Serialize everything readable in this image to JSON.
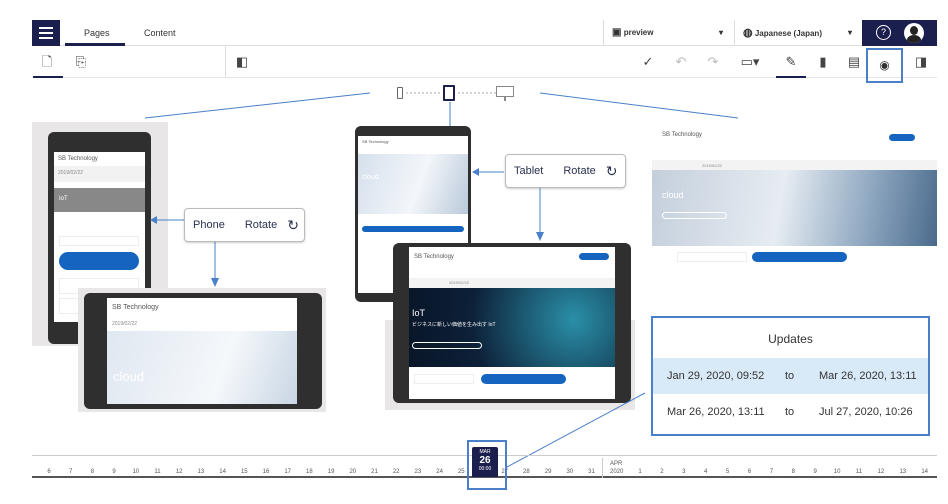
{
  "header": {
    "tabs": [
      {
        "label": "Pages",
        "active": true
      },
      {
        "label": "Content"
      }
    ],
    "environment": "preview",
    "language": "Japanese (Japan)"
  },
  "icons": [
    "menu-icon",
    "page-icon",
    "asset-icon",
    "collapse-panel-icon",
    "check-circle-icon",
    "undo-icon",
    "redo-icon",
    "monitor-icon",
    "pencil-icon",
    "analytics-icon",
    "form-icon",
    "eye-icon",
    "help-icon",
    "avatar-icon",
    "phone-icon",
    "tablet-icon",
    "desktop-icon",
    "rotate-icon"
  ],
  "colors": {
    "navy": "#1b1f4e",
    "highlight": "#4a7fc9",
    "site_blue": "#1565c0",
    "row_highlight": "#d8e9f7"
  },
  "phone_callout": {
    "device": "Phone",
    "rotate": "Rotate"
  },
  "tablet_callout": {
    "device": "Tablet",
    "rotate": "Rotate"
  },
  "site": {
    "logo": "SB Technology",
    "date": "2019/02/22",
    "hero_cloud": "cloud",
    "hero_iot": "IoT",
    "iot_sub": "ビジネスに新しい価値を生み出す IoT"
  },
  "updates": {
    "title": "Updates",
    "rows": [
      {
        "from": "Jan 29, 2020, 09:52",
        "to_label": "to",
        "to": "Mar 26, 2020, 13:11"
      },
      {
        "from": "Mar 26, 2020, 13:11",
        "to_label": "to",
        "to": "Jul 27, 2020, 10:26"
      }
    ]
  },
  "timeline": {
    "selected": {
      "month": "MAR",
      "day": "26",
      "time": "00:00"
    },
    "march_days": [
      "6",
      "7",
      "8",
      "9",
      "10",
      "11",
      "12",
      "13",
      "14",
      "15",
      "16",
      "17",
      "18",
      "19",
      "20",
      "21",
      "22",
      "23",
      "24",
      "25",
      "26",
      "27",
      "28",
      "29",
      "30",
      "31"
    ],
    "april_label": "APR",
    "year": "2020",
    "april_days": [
      "1",
      "2",
      "3",
      "4",
      "5",
      "6",
      "7",
      "8",
      "9",
      "10",
      "11",
      "12",
      "13",
      "14"
    ]
  }
}
